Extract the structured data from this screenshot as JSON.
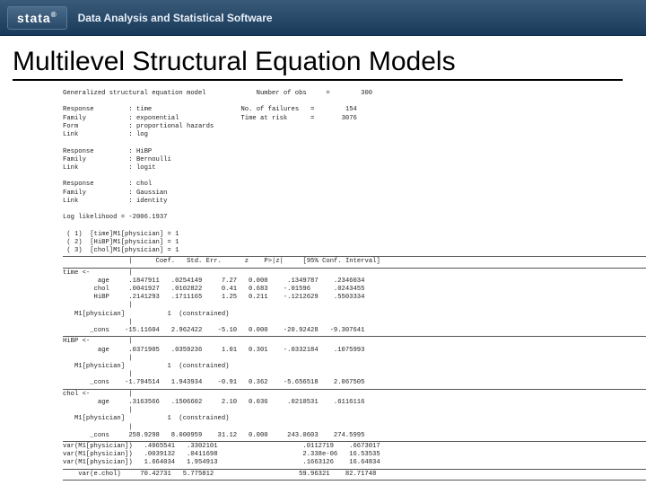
{
  "header": {
    "logo": "stata",
    "logo_sup": "®",
    "tagline": "Data Analysis and Statistical Software"
  },
  "title": "Multilevel Structural Equation Models",
  "out": {
    "model_title": "Generalized structural equation model",
    "nobs_lbl": "Number of obs",
    "nobs": "300",
    "resp1_lbl": "Response",
    "resp1_val": ": time",
    "fam1_lbl": "Family",
    "fam1_val": ": exponential",
    "form1_lbl": "Form",
    "form1_val": ": proportional hazards",
    "link1_lbl": "Link",
    "link1_val": ": log",
    "nfail_lbl": "No. of failures",
    "nfail": "154",
    "trisk_lbl": "Time at risk",
    "trisk": "3076",
    "resp2_lbl": "Response",
    "resp2_val": ": HiBP",
    "fam2_lbl": "Family",
    "fam2_val": ": Bernoulli",
    "link2_lbl": "Link",
    "link2_val": ": logit",
    "resp3_lbl": "Response",
    "resp3_val": ": chol",
    "fam3_lbl": "Family",
    "fam3_val": ": Gaussian",
    "link3_lbl": "Link",
    "link3_val": ": identity",
    "ll_lbl": "Log likelihood = ",
    "ll": "-2006.1937",
    "c1": " ( 1)  [time]M1[physician] = 1",
    "c2": " ( 2)  [HiBP]M1[physician] = 1",
    "c3": " ( 3)  [chol]M1[physician] = 1",
    "hdr_coef": "Coef.",
    "hdr_se": "Std. Err.",
    "hdr_z": "z",
    "hdr_p": "P>|z|",
    "hdr_ci": "[95% Conf. Interval]",
    "sec_time": "time <-",
    "r_age1": "         age     .1847911   .0254149     7.27   0.000     .1349787    .2346034",
    "r_chol1": "        chol     .0041927   .0102822     0.41   0.683    -.01596      .0243455",
    "r_hibp1": "        HiBP     .2141293   .1711165     1.25   0.211    -.1212629    .5503334",
    "mphys": "M1[physician]           1  (constrained)",
    "r_cons1": "       _cons    -15.11604   2.962422    -5.10   0.000    -20.92428   -9.307641",
    "sec_hibp": "HiBP <-",
    "r_age2": "         age     .0371905   .0359236     1.01   0.301    -.0332184    .1075993",
    "r_cons2": "       _cons    -1.794514   1.943934    -0.91   0.362    -5.656518    2.067505",
    "sec_chol": "chol <-",
    "r_age3": "         age     .3163566   .1506602     2.10   0.036     .0210531    .6116116",
    "r_cons3": "       _cons     258.9298   8.000959    31.12   0.000     243.0603    274.5995",
    "var1": "var(M1[physician])   .4065541   .3302101                      .0112719    .6673017",
    "var2": "var(M1[physician])   .0039132   .0411698                      2.338e-06   16.53535",
    "var3": "var(M1[physician])   1.664034   1.954913                      .1663126    16.64834",
    "vare": "    var(e.chol)     70.42731   5.775812                      59.96321    82.71748"
  }
}
